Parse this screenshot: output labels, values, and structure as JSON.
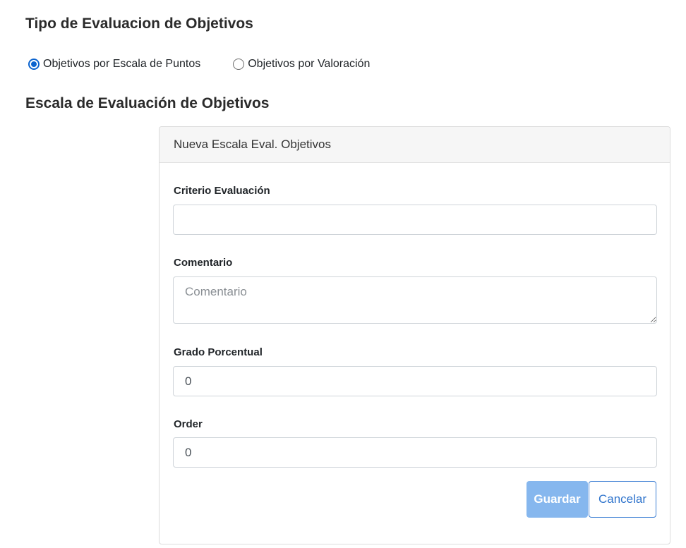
{
  "section_type": {
    "title": "Tipo de Evaluacion de Objetivos",
    "options": [
      {
        "label": "Objetivos por Escala de Puntos",
        "checked": true
      },
      {
        "label": "Objetivos por Valoración",
        "checked": false
      }
    ]
  },
  "section_scale": {
    "title": "Escala de Evaluación de Objetivos"
  },
  "card": {
    "header": "Nueva Escala Eval. Objetivos",
    "fields": {
      "criterio": {
        "label": "Criterio Evaluación",
        "value": "",
        "placeholder": ""
      },
      "comentario": {
        "label": "Comentario",
        "value": "",
        "placeholder": "Comentario"
      },
      "grado": {
        "label": "Grado Porcentual",
        "value": "0"
      },
      "order": {
        "label": "Order",
        "value": "0"
      }
    },
    "buttons": {
      "save": "Guardar",
      "cancel": "Cancelar"
    }
  },
  "colors": {
    "primary": "#0b63ce",
    "save_button_bg": "#86b7ee",
    "cancel_button_border": "#3d7fd4"
  }
}
